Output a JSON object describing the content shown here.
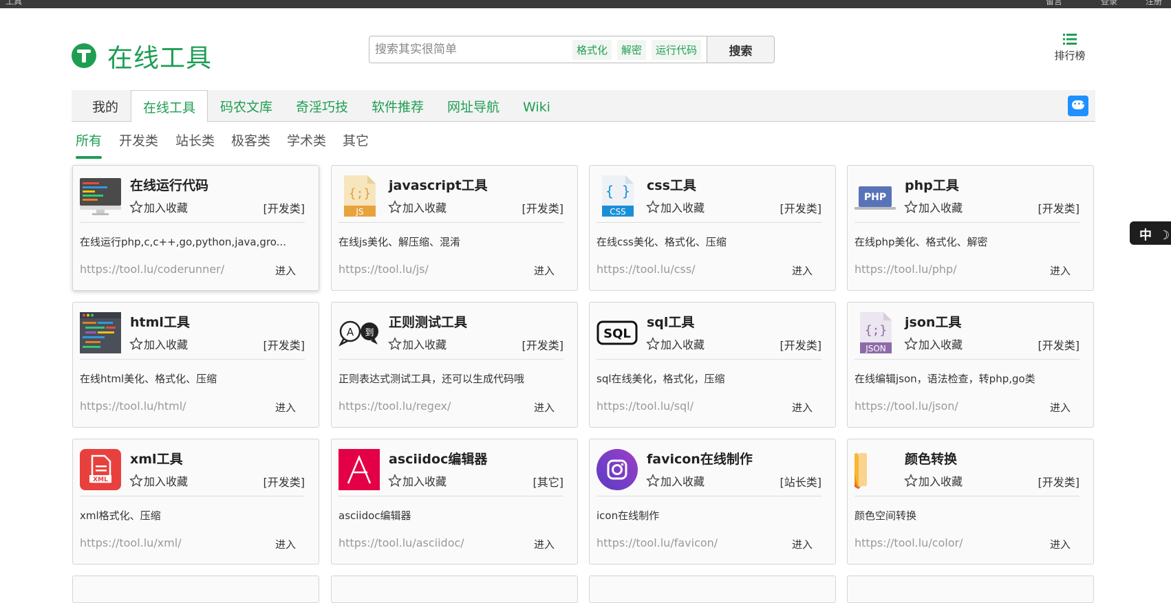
{
  "topbar": {
    "left_text": "工具",
    "right_text_1": "留言",
    "right_text_2": "登录",
    "right_text_3": "注册"
  },
  "header": {
    "logo_text": "在线工具",
    "search_placeholder": "搜索其实很简单",
    "search_tags": [
      "格式化",
      "解密",
      "运行代码"
    ],
    "search_button": "搜索",
    "rank_label": "排行榜"
  },
  "nav": {
    "items": [
      "我的",
      "在线工具",
      "码农文库",
      "奇淫巧技",
      "软件推荐",
      "网址导航",
      "Wiki"
    ],
    "active": "在线工具"
  },
  "filters": {
    "items": [
      "所有",
      "开发类",
      "站长类",
      "极客类",
      "学术类",
      "其它"
    ],
    "active": "所有"
  },
  "fav_label": "加入收藏",
  "enter_label": "进入",
  "lang_pill": {
    "label": "中",
    "moon": "☽"
  },
  "cards": [
    {
      "title": "在线运行代码",
      "category": "[开发类]",
      "desc": "在线运行php,c,c++,go,python,java,gro...",
      "url": "https://tool.lu/coderunner/",
      "icon": "monitor-icon"
    },
    {
      "title": "javascript工具",
      "category": "[开发类]",
      "desc": "在线js美化、解压缩、混淆",
      "url": "https://tool.lu/js/",
      "icon": "js-file-icon"
    },
    {
      "title": "css工具",
      "category": "[开发类]",
      "desc": "在线css美化、格式化、压缩",
      "url": "https://tool.lu/css/",
      "icon": "css-file-icon"
    },
    {
      "title": "php工具",
      "category": "[开发类]",
      "desc": "在线php美化、格式化、解密",
      "url": "https://tool.lu/php/",
      "icon": "php-laptop-icon"
    },
    {
      "title": "html工具",
      "category": "[开发类]",
      "desc": "在线html美化、格式化、压缩",
      "url": "https://tool.lu/html/",
      "icon": "code-window-icon"
    },
    {
      "title": "正则测试工具",
      "category": "[开发类]",
      "desc": "正则表达式测试工具，还可以生成代码哦",
      "url": "https://tool.lu/regex/",
      "icon": "regex-bubbles-icon"
    },
    {
      "title": "sql工具",
      "category": "[开发类]",
      "desc": "sql在线美化，格式化，压缩",
      "url": "https://tool.lu/sql/",
      "icon": "sql-icon"
    },
    {
      "title": "json工具",
      "category": "[开发类]",
      "desc": "在线编辑json，语法检查，转php,go类",
      "url": "https://tool.lu/json/",
      "icon": "json-file-icon"
    },
    {
      "title": "xml工具",
      "category": "[开发类]",
      "desc": "xml格式化、压缩",
      "url": "https://tool.lu/xml/",
      "icon": "xml-file-icon"
    },
    {
      "title": "asciidoc编辑器",
      "category": "[其它]",
      "desc": "asciidoc编辑器",
      "url": "https://tool.lu/asciidoc/",
      "icon": "asciidoc-icon"
    },
    {
      "title": "favicon在线制作",
      "category": "[站长类]",
      "desc": "icon在线制作",
      "url": "https://tool.lu/favicon/",
      "icon": "instagram-camera-icon"
    },
    {
      "title": "颜色转换",
      "category": "[开发类]",
      "desc": "颜色空间转换",
      "url": "https://tool.lu/color/",
      "icon": "color-swatch-icon"
    }
  ]
}
